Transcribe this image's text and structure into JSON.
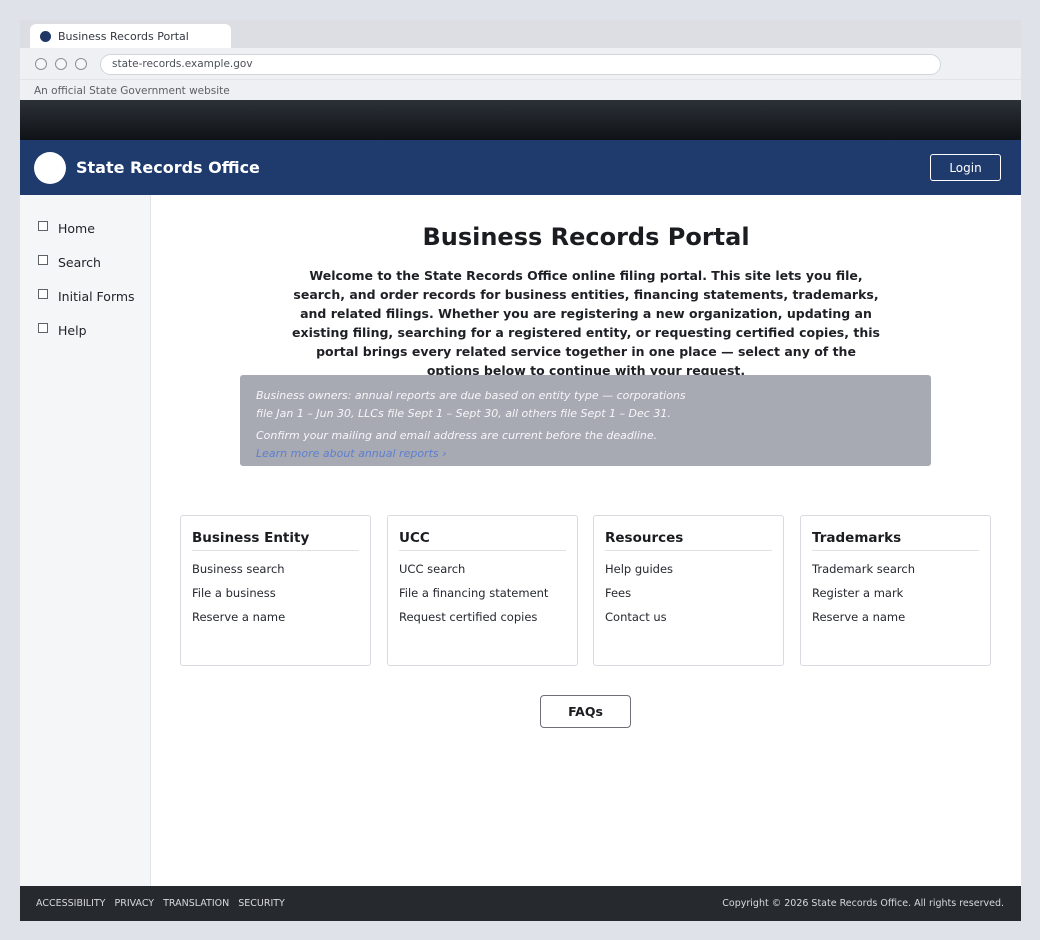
{
  "browser": {
    "tab_title": "Business Records Portal",
    "url": "state-records.example.gov"
  },
  "gov_banner": {
    "text": "An official State Government website"
  },
  "header": {
    "site_name": "State Records Office",
    "login_label": "Login"
  },
  "sidebar": {
    "items": [
      {
        "label": "Home"
      },
      {
        "label": "Search"
      },
      {
        "label": "Initial Forms"
      },
      {
        "label": "Help"
      }
    ]
  },
  "main": {
    "title": "Business Records Portal",
    "intro": "Welcome to the State Records Office online filing portal. This site lets you file, search, and order records for business entities, financing statements, trademarks, and related filings. Whether you are registering a new organization, updating an existing filing, searching for a registered entity, or requesting certified copies, this portal brings every related service together in one place — select any of the options below to continue with your request.",
    "notice": {
      "line1": "Business owners: annual reports are due based on entity type — corporations file Jan 1 – Jun 30, LLCs file Sept 1 – Sept 30, all others file Sept 1 – Dec 31.",
      "line2": "Confirm your mailing and email address are current before the deadline.",
      "link": "Learn more about annual reports ›"
    },
    "cards": [
      {
        "title": "Business Entity",
        "links": [
          "Business search",
          "File a business",
          "Reserve a name"
        ]
      },
      {
        "title": "UCC",
        "links": [
          "UCC search",
          "File a financing statement",
          "Request certified copies"
        ]
      },
      {
        "title": "Resources",
        "links": [
          "Help guides",
          "Fees",
          "Contact us"
        ]
      },
      {
        "title": "Trademarks",
        "links": [
          "Trademark search",
          "Register a mark",
          "Reserve a name"
        ]
      }
    ],
    "faq_label": "FAQs"
  },
  "footer": {
    "links": [
      "ACCESSIBILITY",
      "PRIVACY",
      "TRANSLATION",
      "SECURITY"
    ],
    "copyright": "Copyright © 2026 State Records Office. All rights reserved."
  },
  "colors": {
    "header_bg": "#1f3a6d",
    "notice_bg": "#a7a9b3",
    "notice_link": "#5e7fd0",
    "footer_bg": "#262a2f"
  }
}
